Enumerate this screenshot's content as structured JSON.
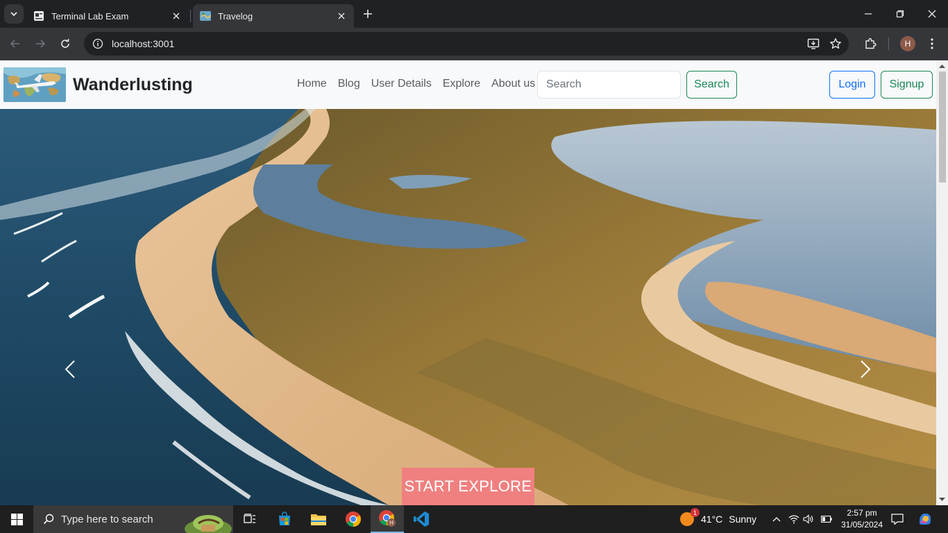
{
  "browser": {
    "tabs": [
      {
        "title": "Terminal Lab Exam",
        "favicon": "document-icon",
        "active": false
      },
      {
        "title": "Travelog",
        "favicon": "map-icon",
        "active": true
      }
    ],
    "address": "localhost:3001",
    "profile_initial": "H"
  },
  "site": {
    "brand": "Wanderlusting",
    "nav": [
      "Home",
      "Blog",
      "User Details",
      "Explore",
      "About us"
    ],
    "search_placeholder": "Search",
    "search_button": "Search",
    "login_button": "Login",
    "signup_button": "Signup",
    "cta": "START EXPLORE",
    "colors": {
      "navbar_bg": "#f8f9fa",
      "success": "#198754",
      "primary": "#0d6efd",
      "cta_bg": "#f08080"
    }
  },
  "taskbar": {
    "search_placeholder": "Type here to search",
    "weather": {
      "temp": "41°C",
      "condition": "Sunny",
      "alerts": "1"
    },
    "time": "2:57 pm",
    "date": "31/05/2024",
    "apps": [
      "task-view-icon",
      "store-icon",
      "file-explorer-icon",
      "chrome-icon",
      "chrome-profile-icon",
      "vscode-icon"
    ]
  }
}
